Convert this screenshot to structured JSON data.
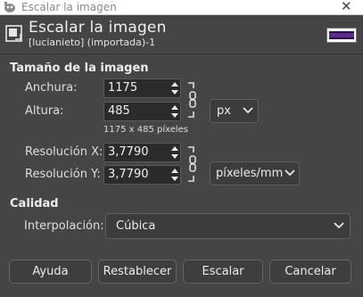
{
  "window": {
    "title": "Escalar la imagen",
    "close_glyph": "✕"
  },
  "header": {
    "title": "Escalar la imagen",
    "subtitle": "[lucianieto] (importada)-1",
    "icon": "scale-icon",
    "thumbnail_colors": [
      "#5b2c8a",
      "#2a0f4d"
    ]
  },
  "size_section": {
    "title": "Tamaño de la imagen",
    "width_label": "Anchura:",
    "width_value": "1175",
    "height_label": "Altura:",
    "height_value": "485",
    "unit": "px",
    "pixels_summary": "1175 x 485 píxeles",
    "xres_label": "Resolución X:",
    "xres_value": "3,7790",
    "yres_label": "Resolución Y:",
    "yres_value": "3,7790",
    "res_unit": "píxeles/mm"
  },
  "quality_section": {
    "title": "Calidad",
    "interp_label": "Interpolación:",
    "interp_value": "Cúbica"
  },
  "buttons": {
    "help": "Ayuda",
    "reset": "Restablecer",
    "scale": "Escalar",
    "cancel": "Cancelar"
  },
  "colors": {
    "background": "#454545",
    "field": "#2b2b2b",
    "button": "#3e3e3e"
  }
}
